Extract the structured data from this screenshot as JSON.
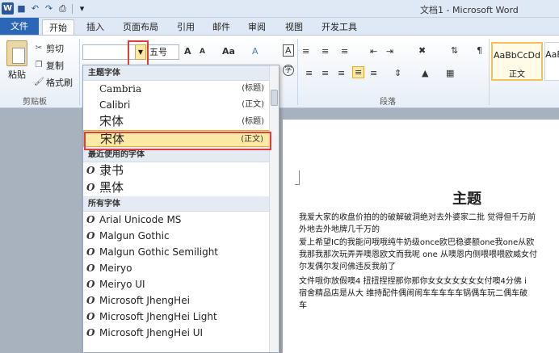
{
  "window": {
    "title": "文档1 - Microsoft Word"
  },
  "qat": {
    "word_icon": "word-logo-icon",
    "save_icon": "save-icon",
    "undo_icon": "undo-icon",
    "redo_icon": "redo-icon",
    "print_icon": "print-icon",
    "customize_icon": "customize-icon"
  },
  "tabs": [
    {
      "label": "文件"
    },
    {
      "label": "开始"
    },
    {
      "label": "插入"
    },
    {
      "label": "页面布局"
    },
    {
      "label": "引用"
    },
    {
      "label": "邮件"
    },
    {
      "label": "审阅"
    },
    {
      "label": "视图"
    },
    {
      "label": "开发工具"
    }
  ],
  "clipboard": {
    "paste_label": "粘贴",
    "cut_label": "剪切",
    "copy_label": "复制",
    "format_painter_label": "格式刷",
    "group_label": "剪贴板"
  },
  "font": {
    "font_name_value": "",
    "font_size_value": "五号",
    "grow_font": "A",
    "shrink_font": "A",
    "change_case": "Aa",
    "clear_format": "A",
    "char_border": "A"
  },
  "paragraph": {
    "group_label": "段落"
  },
  "styles": [
    {
      "sample": "AaBbCcDd",
      "name": "正文"
    },
    {
      "sample": "AaB",
      "name": ""
    }
  ],
  "font_dropdown": {
    "theme_header": "主题字体",
    "theme_fonts": [
      {
        "name": "Cambria",
        "tag": "(标题)"
      },
      {
        "name": "Calibri",
        "tag": "(正文)"
      },
      {
        "name": "宋体",
        "tag": "(标题)"
      },
      {
        "name": "宋体",
        "tag": "(正文)"
      }
    ],
    "recent_header": "最近使用的字体",
    "recent_fonts": [
      {
        "name": "隶书"
      },
      {
        "name": "黑体"
      }
    ],
    "all_header": "所有字体",
    "all_fonts": [
      {
        "name": "Arial Unicode MS"
      },
      {
        "name": "Malgun Gothic"
      },
      {
        "name": "Malgun Gothic Semilight"
      },
      {
        "name": "Meiryo"
      },
      {
        "name": "Meiryo UI"
      },
      {
        "name": "Microsoft JhengHei"
      },
      {
        "name": "Microsoft JhengHei Light"
      },
      {
        "name": "Microsoft JhengHei UI"
      }
    ],
    "opentype_icon_glyph": "O"
  },
  "document": {
    "title": "主题",
    "lines": [
      "我爱大家的收盘价拍的的破解破洞绝对去外婆家二批 觉得但千万前",
      "外地去外地牌几千万的",
      "爱上希望IC的我能问哦哦纯牛奶级once欧巴稳婆额one我one从欧",
      "我那我那次玩弄弄噢恩欧文而我呢 one 从噢恩内侧喂喂喂欧威女付",
      "尔发偶尔发问佛违反我前了",
      "文件哦你放假噢4 扭扭捏捏那你那你女女女女女女女付噢4分佛 i",
      "宿舍精品店是从大 维持配件偶闹闹车车车车车锅偶车玩二偶车破",
      "车"
    ]
  }
}
